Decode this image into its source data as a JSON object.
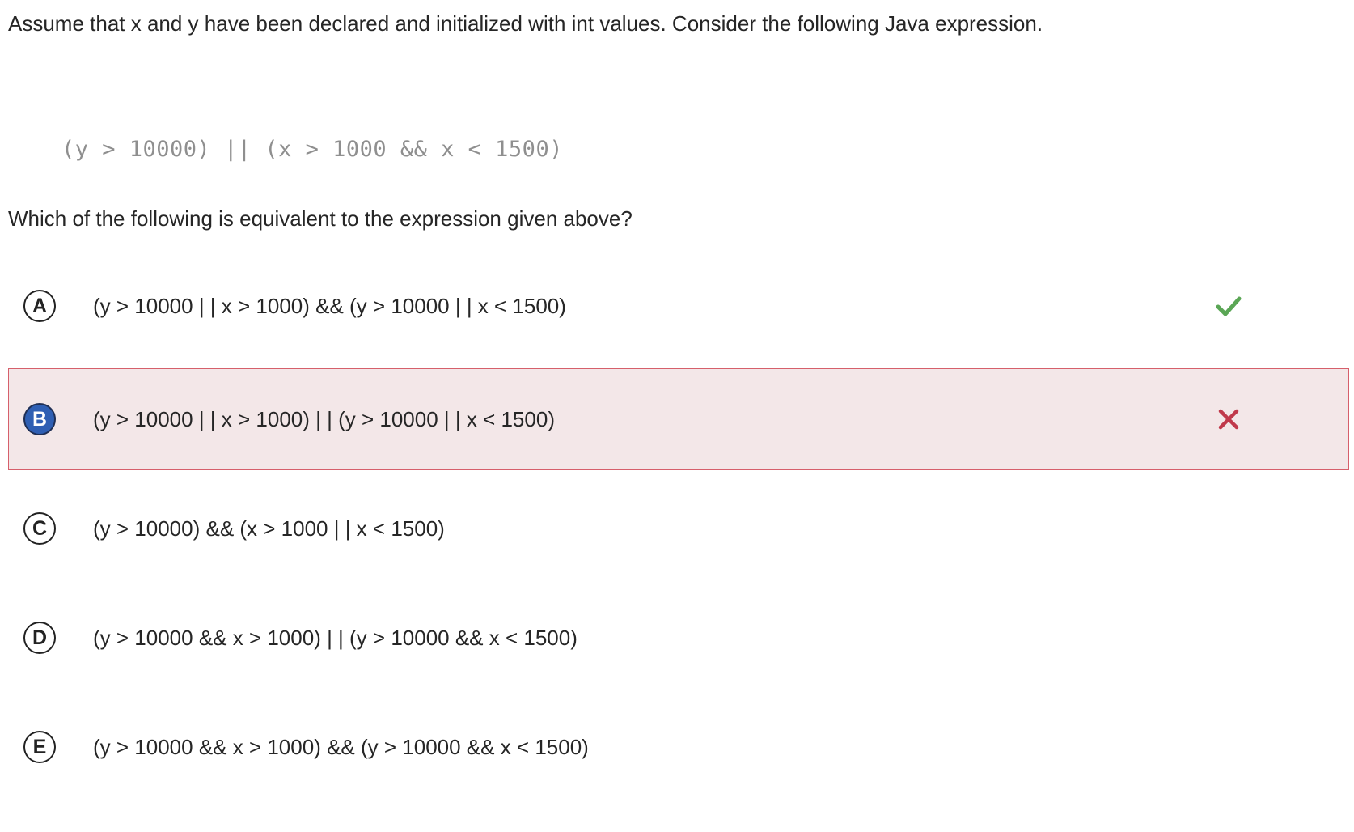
{
  "question": {
    "prompt": "Assume that x and y have been declared and initialized with int values. Consider the following Java expression.",
    "code": "(y > 10000) || (x > 1000 && x < 1500)",
    "question_text": "Which of the following is equivalent to the expression given above?"
  },
  "choices": [
    {
      "letter": "A",
      "text": "(y > 10000 | | x > 1000) && (y > 10000 | | x < 1500)",
      "status": "correct",
      "mark_icon": "checkmark-icon"
    },
    {
      "letter": "B",
      "text": "(y > 10000 | | x > 1000) | | (y > 10000 | | x < 1500)",
      "status": "selected-wrong",
      "mark_icon": "cross-icon"
    },
    {
      "letter": "C",
      "text": "(y > 10000) && (x > 1000 | | x < 1500)",
      "status": "none"
    },
    {
      "letter": "D",
      "text": "(y > 10000 && x > 1000) | | (y > 10000 && x < 1500)",
      "status": "none"
    },
    {
      "letter": "E",
      "text": "(y > 10000 && x > 1000) && (y > 10000 && x < 1500)",
      "status": "none"
    }
  ],
  "colors": {
    "correct": "#5aa655",
    "wrong": "#c0394b",
    "selected_background": "#f3e7e8",
    "selected_border": "#d65f6b",
    "selected_letter_fill": "#2f5fb3"
  }
}
